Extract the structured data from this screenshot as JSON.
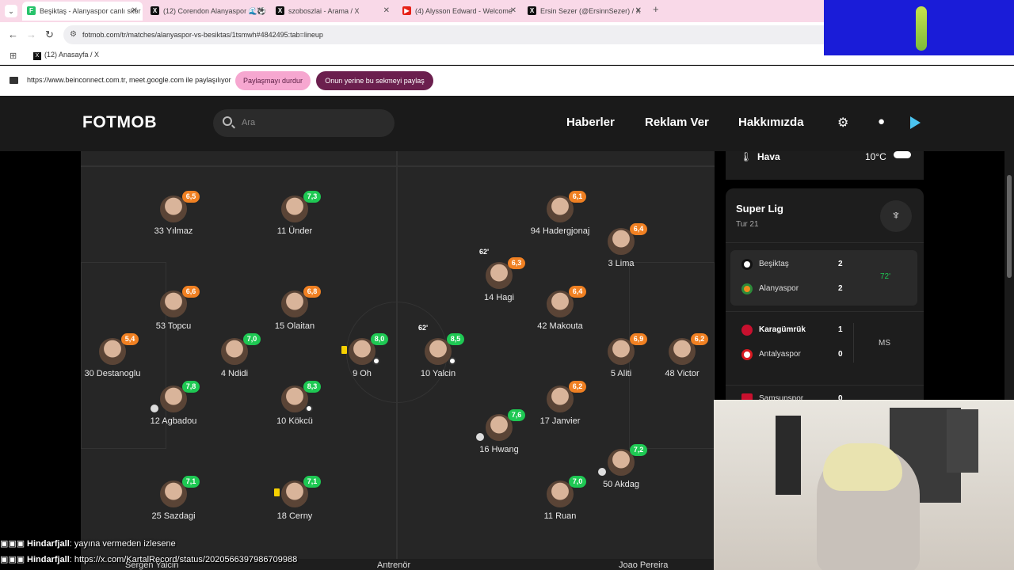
{
  "browser": {
    "tabs": [
      {
        "title": "Beşiktaş - Alanyaspor canlı skor",
        "active": true,
        "favicon": "fotmob-icon",
        "color": "#27c36b"
      },
      {
        "title": "(12) Corendon Alanyaspor 🌊⚽",
        "active": false,
        "favicon": "x-icon",
        "color": "#111111"
      },
      {
        "title": "szoboszlai - Arama / X",
        "active": false,
        "favicon": "x-icon",
        "color": "#111111"
      },
      {
        "title": "(4) Alysson Edward - Welcome",
        "active": false,
        "favicon": "youtube-icon",
        "color": "#e62117"
      },
      {
        "title": "Ersin Sezer (@ErsinnSezer) / X",
        "active": false,
        "favicon": "x-icon",
        "color": "#111111"
      }
    ],
    "url": "fotmob.com/tr/matches/alanyaspor-vs-besiktas/1tsmwh#4842495:tab=lineup",
    "bookmark": "(12) Anasayfa / X",
    "share": {
      "text": "https://www.beinconnect.com.tr, meet.google.com ile paylaşılıyor",
      "stop_label": "Paylaşmayı durdur",
      "switch_label": "Onun yerine bu sekmeyi paylaş"
    }
  },
  "fotmob": {
    "logo": "FOTMOB",
    "search_placeholder": "Ara",
    "nav": [
      "Haberler",
      "Reklam Ver",
      "Hakkımızda"
    ]
  },
  "weather": {
    "label": "Hava",
    "temp": "10°C"
  },
  "league": {
    "name": "Super Lig",
    "round": "Tur 21",
    "matches": [
      {
        "home": "Beşiktaş",
        "home_score": "2",
        "away": "Alanyaspor",
        "away_score": "2",
        "status": "72'",
        "status_color": "#1ec853",
        "active": true,
        "home_bold": false
      },
      {
        "home": "Karagümrük",
        "home_score": "1",
        "away": "Antalyaspor",
        "away_score": "0",
        "status": "MS",
        "status_color": "#cccccc",
        "active": false,
        "home_bold": true
      },
      {
        "home": "Samsunspor",
        "home_score": "0"
      }
    ]
  },
  "players": [
    {
      "name": "33 Yılmaz",
      "rating": "6,5",
      "color": "orange"
    },
    {
      "name": "11 Ünder",
      "rating": "7,3",
      "color": "green"
    },
    {
      "name": "94 Hadergjonaj",
      "rating": "6,1",
      "color": "orange"
    },
    {
      "name": "3 Lima",
      "rating": "6,4",
      "color": "orange"
    },
    {
      "name": "14 Hagi",
      "rating": "6,3",
      "color": "orange",
      "sub": "62'"
    },
    {
      "name": "53 Topcu",
      "rating": "6,6",
      "color": "orange"
    },
    {
      "name": "15 Olaitan",
      "rating": "6,8",
      "color": "orange"
    },
    {
      "name": "42 Makouta",
      "rating": "6,4",
      "color": "orange"
    },
    {
      "name": "30 Destanoglu",
      "rating": "5,4",
      "color": "orange"
    },
    {
      "name": "4 Ndidi",
      "rating": "7,0",
      "color": "green"
    },
    {
      "name": "9 Oh",
      "rating": "8,0",
      "color": "green"
    },
    {
      "name": "10 Yalcin",
      "rating": "8,5",
      "color": "green",
      "sub": "62'"
    },
    {
      "name": "5 Aliti",
      "rating": "6,9",
      "color": "orange"
    },
    {
      "name": "48 Victor",
      "rating": "6,2",
      "color": "orange"
    },
    {
      "name": "12 Agbadou",
      "rating": "7,8",
      "color": "green"
    },
    {
      "name": "10 Kökcü",
      "rating": "8,3",
      "color": "green"
    },
    {
      "name": "17 Janvier",
      "rating": "6,2",
      "color": "orange"
    },
    {
      "name": "16 Hwang",
      "rating": "7,6",
      "color": "green"
    },
    {
      "name": "50 Akdag",
      "rating": "7,2",
      "color": "green"
    },
    {
      "name": "25 Sazdagi",
      "rating": "7,1",
      "color": "green"
    },
    {
      "name": "18 Cerny",
      "rating": "7,1",
      "color": "green"
    },
    {
      "name": "11 Ruan",
      "rating": "7,0",
      "color": "green"
    }
  ],
  "bottom": {
    "left": "Sergen Yalcin",
    "center": "Antrenör",
    "right": "Joao Pereira"
  },
  "chat": [
    {
      "user": "Hindarfjall",
      "message": ": yayına vermeden izlesene"
    },
    {
      "user": "Hindarfjall",
      "message": ": https://x.com/KartalRecord/status/2020566397986709988"
    }
  ]
}
